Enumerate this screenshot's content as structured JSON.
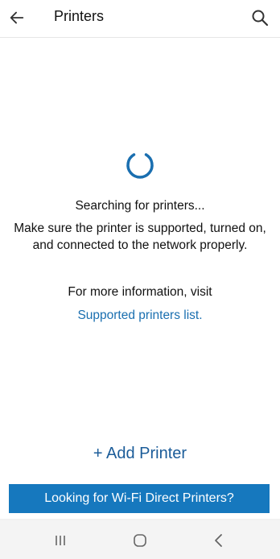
{
  "app_bar": {
    "title": "Printers",
    "back_icon": "arrow-left-icon",
    "search_icon": "search-icon"
  },
  "main": {
    "status": "Searching for printers...",
    "hint": "Make sure the printer is supported, turned on, and connected to the network properly.",
    "more_info": "For more information, visit",
    "link_label": "Supported printers list.",
    "add_printer_label": "+ Add Printer",
    "wifi_direct_label": "Looking for Wi-Fi Direct Printers?"
  },
  "nav_bar": {
    "recents_icon": "recents-icon",
    "home_icon": "home-icon",
    "back_icon": "back-chevron-icon"
  },
  "colors": {
    "accent": "#1678be",
    "link": "#1a6fb0",
    "add_printer": "#1b5c99",
    "spinner": "#1a6fb0"
  }
}
